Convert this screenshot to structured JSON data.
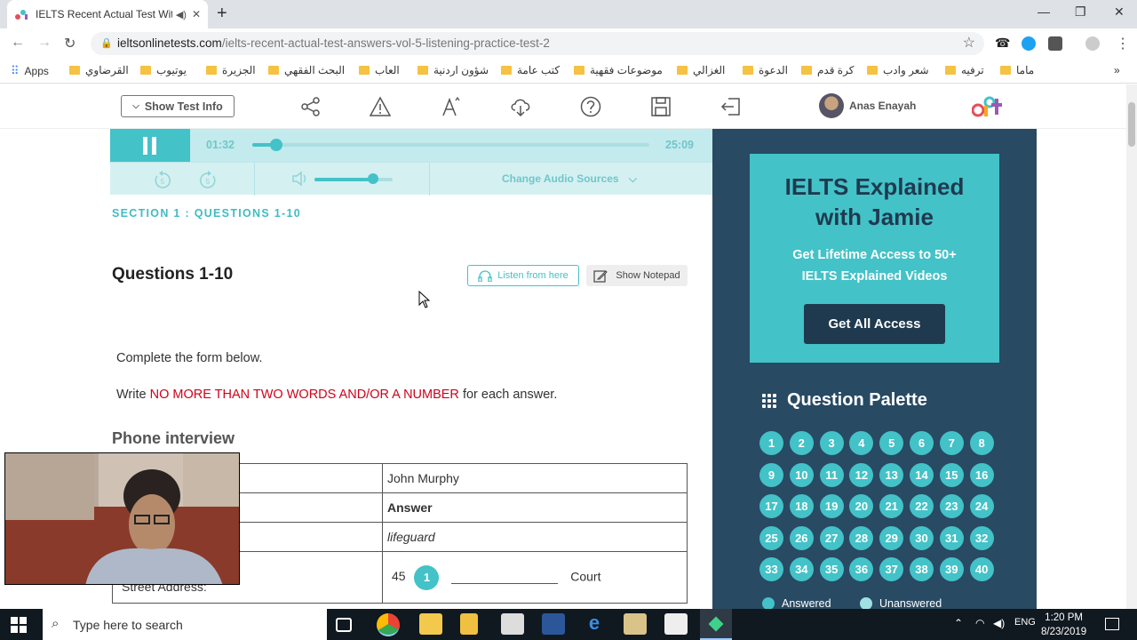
{
  "browser": {
    "tab_title": "IELTS Recent Actual Test With",
    "url_domain": "ieltsonlinetests.com",
    "url_path": "/ielts-recent-actual-test-answers-vol-5-listening-practice-test-2",
    "bookmarks": [
      "Apps",
      "القرضاوي",
      "يوتيوب",
      "الجزيرة",
      "البحث الفقهي",
      "العاب",
      "شؤون اردنية",
      "كتب عامة",
      "موضوعات فقهية",
      "الغزالي",
      "الدعوة",
      "كرة قدم",
      "شعر وادب",
      "ترفيه",
      "ماما"
    ],
    "bookmarks_more": "»"
  },
  "header": {
    "show_info_label": "Show Test Info",
    "user_name": "Anas Enayah",
    "icons": [
      "share-icon",
      "warning-icon",
      "font-size-icon",
      "download-icon",
      "help-icon",
      "save-icon",
      "exit-icon"
    ]
  },
  "player": {
    "elapsed": "01:32",
    "total": "25:09",
    "progress": 0.06,
    "volume": 0.75,
    "change_source_label": "Change Audio Sources"
  },
  "content": {
    "section_title": "SECTION 1 : QUESTIONS 1-10",
    "question_heading": "Questions 1-10",
    "listen_label": "Listen from here",
    "notepad_label": "Show Notepad",
    "instruction1": "Complete the form below.",
    "instruction2_pre": "Write ",
    "instruction2_em": "NO MORE THAN TWO WORDS AND/OR A NUMBER",
    "instruction2_post": " for each answer.",
    "form_heading": "Phone interview",
    "rows": [
      {
        "label": "",
        "value": "John Murphy"
      },
      {
        "label": "",
        "value": "Answer"
      },
      {
        "label": ":",
        "value": "lifeguard"
      },
      {
        "label": "Street Address:",
        "prefix": "45",
        "qnum": "1",
        "suffix": "Court"
      }
    ]
  },
  "sidebar": {
    "promo_title_1": "IELTS Explained",
    "promo_title_2": "with Jamie",
    "promo_sub_1": "Get Lifetime Access to 50+",
    "promo_sub_2": "IELTS Explained Videos",
    "promo_button": "Get All Access",
    "palette_title": "Question Palette",
    "questions": [
      "1",
      "2",
      "3",
      "4",
      "5",
      "6",
      "7",
      "8",
      "9",
      "10",
      "11",
      "12",
      "13",
      "14",
      "15",
      "16",
      "17",
      "18",
      "19",
      "20",
      "21",
      "22",
      "23",
      "24",
      "25",
      "26",
      "27",
      "28",
      "29",
      "30",
      "31",
      "32",
      "33",
      "34",
      "35",
      "36",
      "37",
      "38",
      "39",
      "40"
    ],
    "legend_answered": "Answered",
    "legend_unanswered": "Unanswered"
  },
  "taskbar": {
    "search_placeholder": "Type here to search",
    "time": "1:20 PM",
    "date": "8/23/2019",
    "lang": "ENG"
  },
  "colors": {
    "accent": "#43c2c8",
    "sidebar_bg": "#284a63",
    "emphasis_red": "#d0021b"
  }
}
